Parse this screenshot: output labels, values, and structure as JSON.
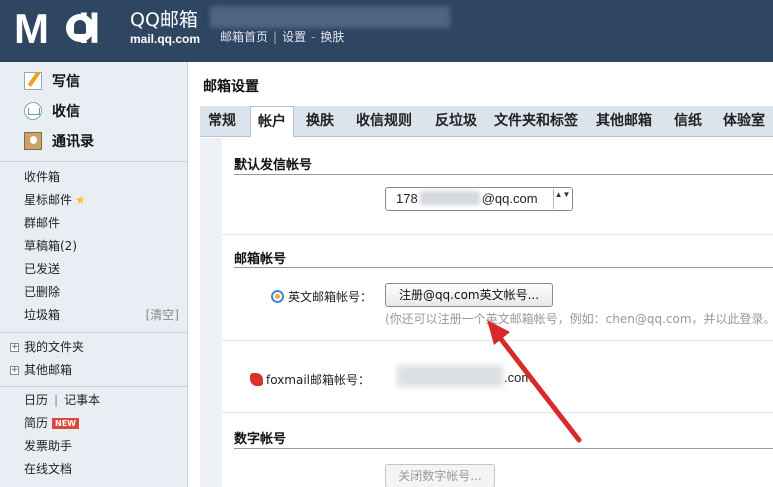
{
  "header": {
    "logo_word": "M",
    "logo_word_end": "il",
    "logo_cn": "QQ邮箱",
    "logo_domain": "mail.qq.com",
    "links": [
      "邮箱首页",
      "设置",
      "换肤"
    ],
    "separator": "|",
    "dash": "-",
    "bg_color": "#2f4663"
  },
  "sidebar": {
    "primary": [
      {
        "label": "写信",
        "icon": "compose-icon"
      },
      {
        "label": "收信",
        "icon": "inbox-icon"
      },
      {
        "label": "通讯录",
        "icon": "contacts-icon"
      }
    ],
    "folders": [
      "收件箱",
      "星标邮件",
      "群邮件",
      "草稿箱(2)",
      "已发送",
      "已删除",
      "垃圾箱"
    ],
    "star": "★",
    "clear_label": "[清空]",
    "groups": [
      "我的文件夹",
      "其他邮箱"
    ],
    "expand_glyph": "+",
    "calendar": "日历",
    "notes": "记事本",
    "pipe": "|",
    "resume": "简历",
    "new_badge": "NEW",
    "invoice": "发票助手",
    "docs": "在线文档"
  },
  "main": {
    "title": "邮箱设置",
    "tabs": [
      "常规",
      "帐户",
      "换肤",
      "收信规则",
      "反垃圾",
      "文件夹和标签",
      "其他邮箱",
      "信纸",
      "体验室"
    ],
    "active_tab": "帐户",
    "default_sender": {
      "title": "默认发信帐号",
      "value_prefix": "178",
      "value_suffix": "@qq.com",
      "arrow_glyph": "▲▼"
    },
    "mailbox_accounts": {
      "title": "邮箱帐号",
      "english_label": "英文邮箱帐号：",
      "register_button": "注册@qq.com英文帐号...",
      "hint": "(你还可以注册一个英文邮箱帐号，例如：chen@qq.com，并以此登录。",
      "foxmail_label": "foxmail邮箱帐号：",
      "foxmail_suffix": ".com"
    },
    "digital_account": {
      "title": "数字帐号",
      "close_button": "关闭数字帐号..."
    }
  },
  "colors": {
    "accent_arrow": "#d92a2a",
    "sidebar_bg": "#e9eef4",
    "tab_bar_bg": "#dbe3ec"
  }
}
